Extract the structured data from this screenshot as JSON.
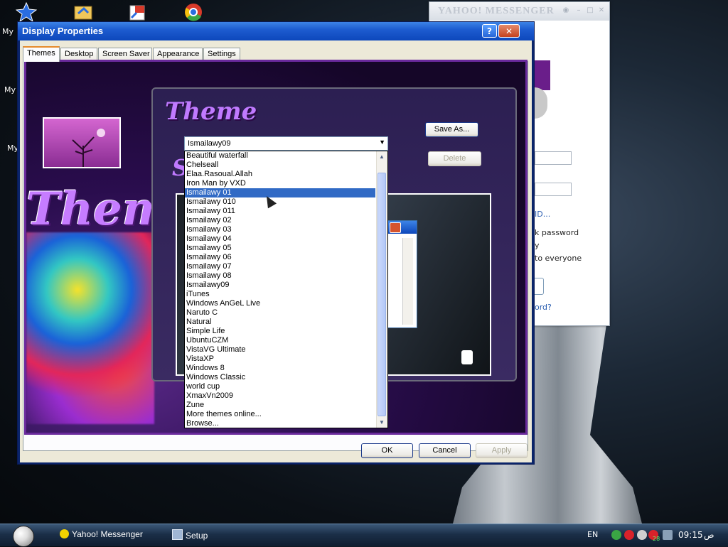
{
  "desktop": {
    "icons": [
      {
        "name": "star-icon"
      },
      {
        "name": "folder-icon"
      },
      {
        "name": "shortcut-icon"
      },
      {
        "name": "chrome-icon"
      }
    ],
    "labels": [
      "My",
      "My",
      "My"
    ]
  },
  "yahoo": {
    "title": "YAHOO! MESSENGER",
    "id_link": "ID...",
    "remember_password": "k password",
    "sign_in_invisible": "y",
    "to_everyone": "to everyone",
    "forgot_link": "ord?"
  },
  "dialog": {
    "title": "Display Properties",
    "help_button": "?",
    "close_button": "✕",
    "tabs": [
      {
        "label": "Themes",
        "active": true
      },
      {
        "label": "Desktop",
        "active": false
      },
      {
        "label": "Screen Saver",
        "active": false
      },
      {
        "label": "Appearance",
        "active": false
      },
      {
        "label": "Settings",
        "active": false
      }
    ],
    "banner_word": "Themes",
    "preview_heading": "Theme",
    "preview_subheading": "S",
    "theme_combo": {
      "value": "Ismailawy09",
      "options": [
        "Beautiful waterfall",
        "Chelseall",
        "Elaa.Rasoual.Allah",
        "Iron Man by VXD",
        "Ismailawy 01",
        "Ismailawy 010",
        "Ismailawy 011",
        "Ismailawy 02",
        "Ismailawy 03",
        "Ismailawy 04",
        "Ismailawy 05",
        "Ismailawy 06",
        "Ismailawy 07",
        "Ismailawy 08",
        "Ismailawy09",
        "iTunes",
        "Windows AnGeL Live",
        "Naruto C",
        "Natural",
        "Simple Life",
        "UbuntuCZM",
        "VistaVG Ultimate",
        "VistaXP",
        "Windows 8",
        "Windows Classic",
        "world cup",
        "XmaxVn2009",
        "Zune",
        "More themes online...",
        "Browse..."
      ],
      "highlighted": "Ismailawy 01"
    },
    "save_as_button": "Save As...",
    "delete_button": "Delete",
    "ok_button": "OK",
    "cancel_button": "Cancel",
    "apply_button": "Apply"
  },
  "taskbar": {
    "tasks": [
      {
        "label": "Yahoo! Messenger",
        "icon": "yahoo-smiley-icon"
      },
      {
        "label": "Setup",
        "icon": "setup-icon"
      }
    ],
    "language": "EN",
    "time": "09:15",
    "ampm": "ص",
    "tray_badge": "28"
  }
}
